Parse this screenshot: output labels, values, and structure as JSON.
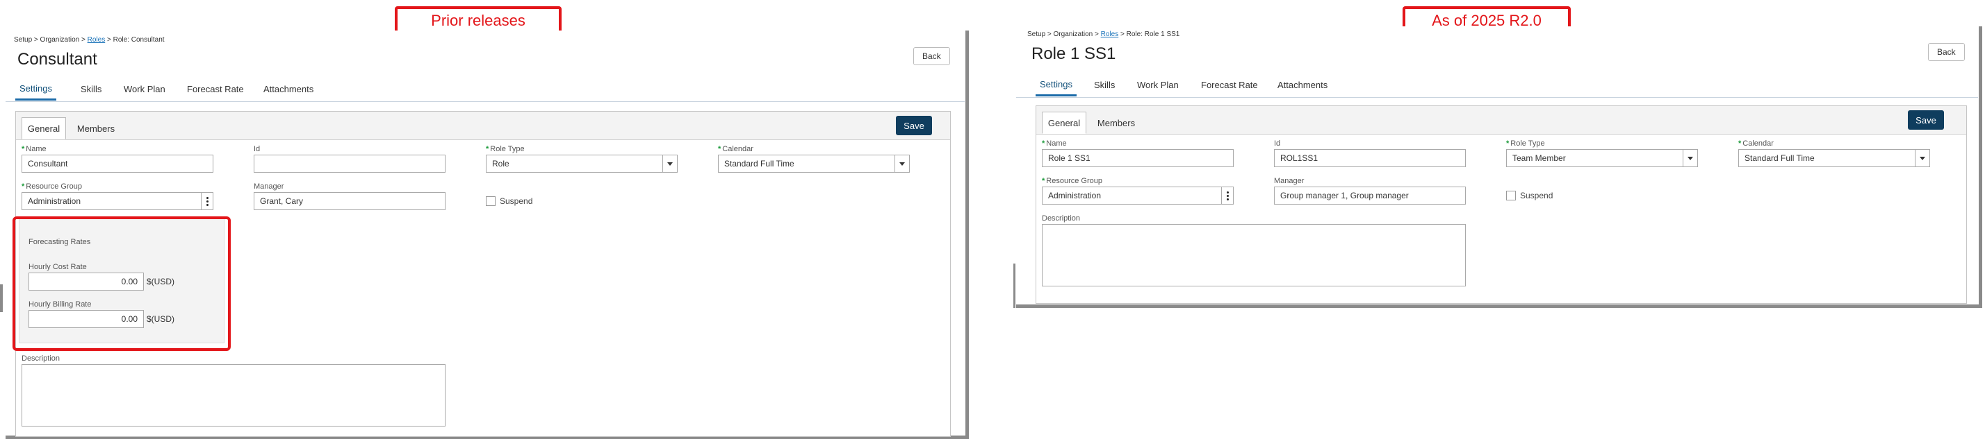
{
  "callouts": {
    "left": "Prior releases",
    "right": "As of 2025 R2.0"
  },
  "left": {
    "breadcrumb": {
      "setup": "Setup",
      "sep1": " > ",
      "organization": "Organization",
      "sep2": " > ",
      "roles": "Roles",
      "sep3": " > ",
      "current": "Role: Consultant"
    },
    "title": "Consultant",
    "back_label": "Back",
    "tabs": [
      "Settings",
      "Skills",
      "Work Plan",
      "Forecast Rate",
      "Attachments"
    ],
    "subtabs": [
      "General",
      "Members"
    ],
    "save_label": "Save",
    "fields": {
      "name_label": "Name",
      "name_value": "Consultant",
      "id_label": "Id",
      "id_value": "",
      "role_type_label": "Role Type",
      "role_type_value": "Role",
      "calendar_label": "Calendar",
      "calendar_value": "Standard Full Time",
      "resource_group_label": "Resource Group",
      "resource_group_value": "Administration",
      "manager_label": "Manager",
      "manager_value": "Grant, Cary",
      "suspend_label": "Suspend",
      "description_label": "Description"
    },
    "forecasting": {
      "heading": "Forecasting Rates",
      "hourly_cost_label": "Hourly Cost Rate",
      "hourly_cost_value": "0.00",
      "hourly_billing_label": "Hourly Billing Rate",
      "hourly_billing_value": "0.00",
      "currency": "$(USD)"
    }
  },
  "right": {
    "breadcrumb": {
      "setup": "Setup",
      "sep1": " > ",
      "organization": "Organization",
      "sep2": " > ",
      "roles": "Roles",
      "sep3": " > ",
      "current": "Role: Role 1 SS1"
    },
    "title": "Role 1 SS1",
    "back_label": "Back",
    "tabs": [
      "Settings",
      "Skills",
      "Work Plan",
      "Forecast Rate",
      "Attachments"
    ],
    "subtabs": [
      "General",
      "Members"
    ],
    "save_label": "Save",
    "fields": {
      "name_label": "Name",
      "name_value": "Role 1 SS1",
      "id_label": "Id",
      "id_value": "ROL1SS1",
      "role_type_label": "Role Type",
      "role_type_value": "Team Member",
      "calendar_label": "Calendar",
      "calendar_value": "Standard Full Time",
      "resource_group_label": "Resource Group",
      "resource_group_value": "Administration",
      "manager_label": "Manager",
      "manager_value": "Group manager 1, Group manager",
      "suspend_label": "Suspend",
      "description_label": "Description"
    }
  },
  "colors": {
    "callout_red": "#e3161a",
    "save_bg": "#0f3d5e",
    "active_tab": "#1a6aa8",
    "required_mark": "#1b9a3a",
    "link": "#1a73b9"
  }
}
